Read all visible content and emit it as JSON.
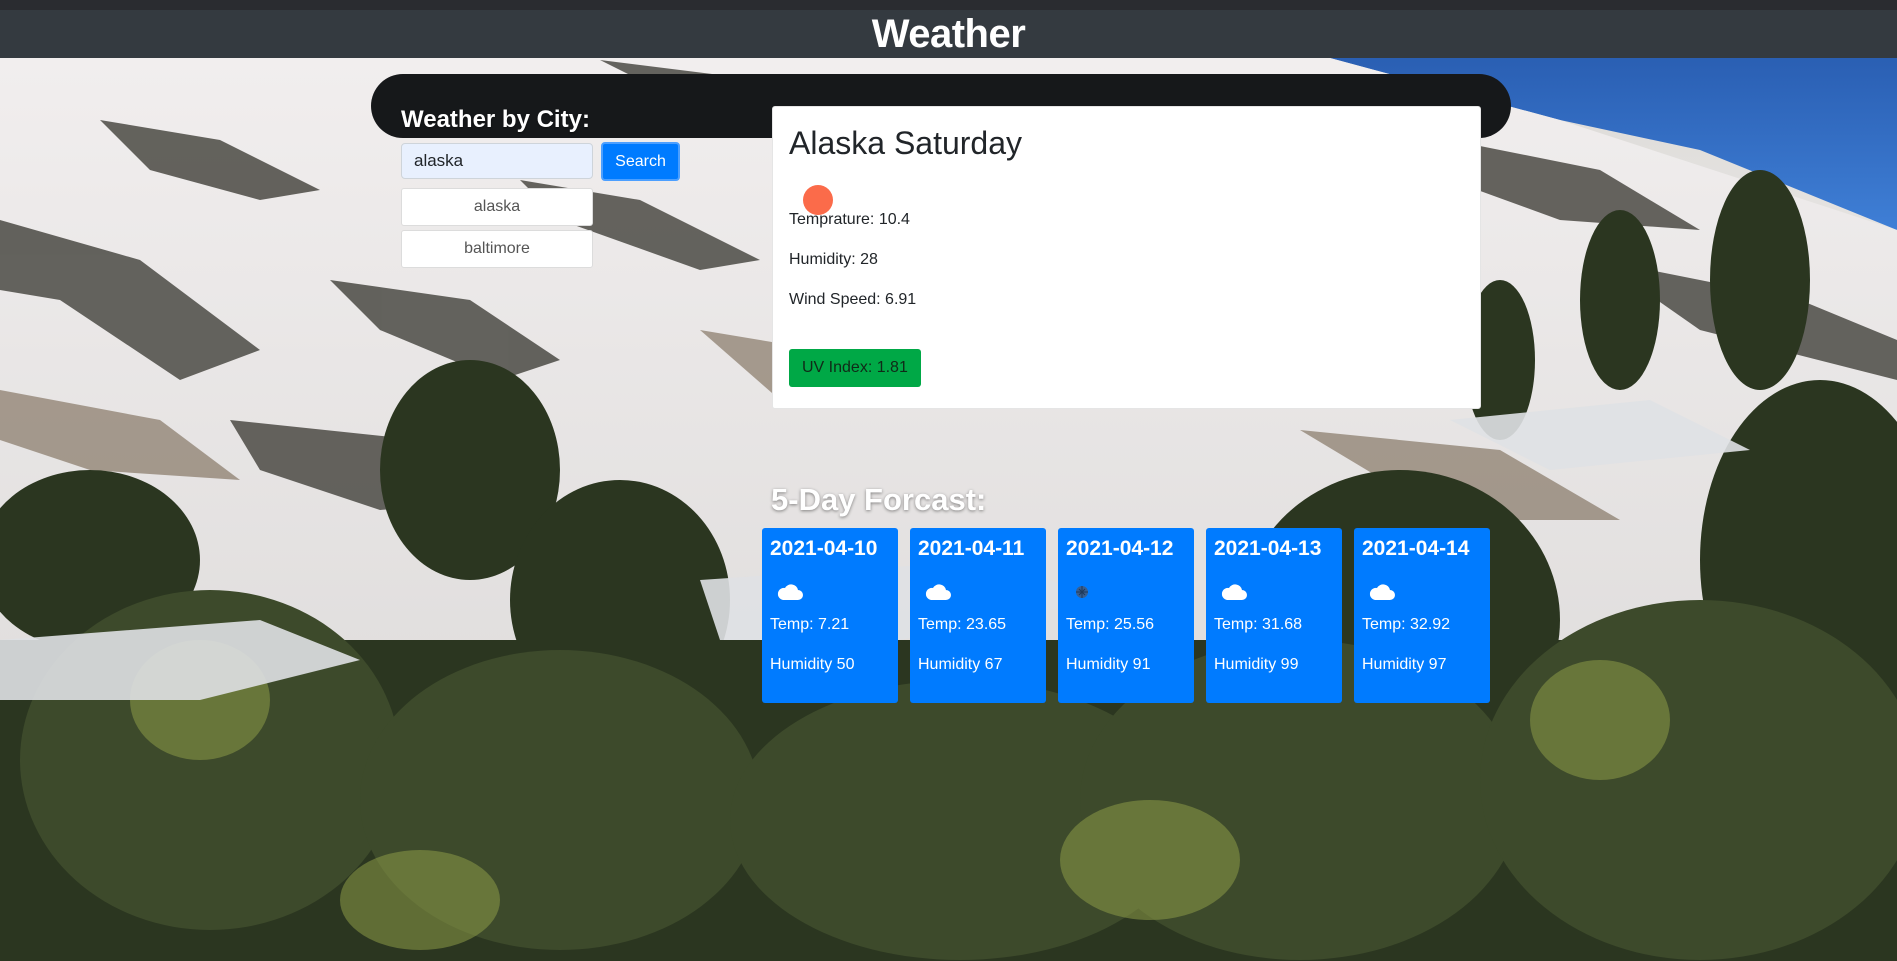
{
  "header": {
    "title": "Weather"
  },
  "sidebar": {
    "title": "Weather by City:",
    "search_value": "alaska",
    "search_button": "Search",
    "history": [
      "alaska",
      "baltimore"
    ]
  },
  "current": {
    "title": "Alaska Saturday",
    "icon": "sun-icon",
    "temperature": "Temprature: 10.4",
    "humidity": "Humidity: 28",
    "wind": "Wind Speed: 6.91",
    "uv": "UV Index: 1.81",
    "uv_color": "#00a846",
    "sun_color": "#fb6b4a"
  },
  "forecast": {
    "title": "5-Day Forcast:",
    "card_color": "#007bff",
    "days": [
      {
        "date": "2021-04-10",
        "icon": "cloud-icon",
        "temp": "Temp: 7.21",
        "humidity": "Humidity 50"
      },
      {
        "date": "2021-04-11",
        "icon": "cloud-icon",
        "temp": "Temp: 23.65",
        "humidity": "Humidity 67"
      },
      {
        "date": "2021-04-12",
        "icon": "rain-icon",
        "temp": "Temp: 25.56",
        "humidity": "Humidity 91"
      },
      {
        "date": "2021-04-13",
        "icon": "cloud-icon",
        "temp": "Temp: 31.68",
        "humidity": "Humidity 99"
      },
      {
        "date": "2021-04-14",
        "icon": "cloud-icon",
        "temp": "Temp: 32.92",
        "humidity": "Humidity 97"
      }
    ]
  }
}
